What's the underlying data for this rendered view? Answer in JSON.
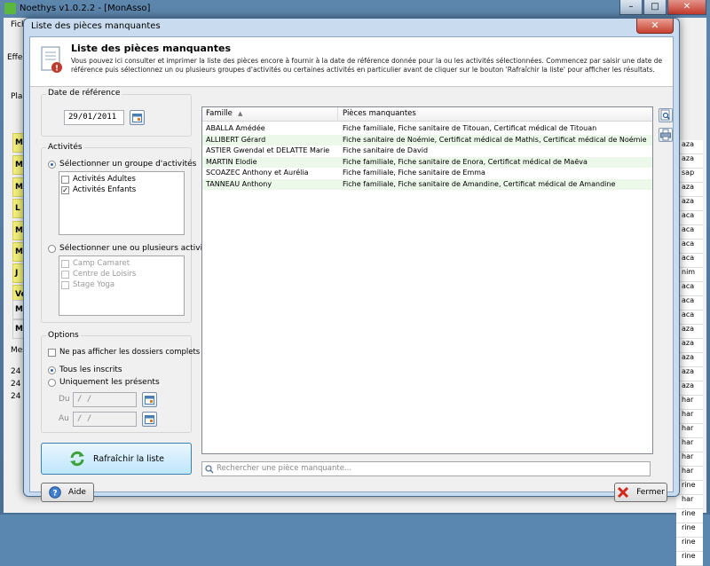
{
  "main_window": {
    "title": "Noethys v1.0.2.2 - [MonAsso]",
    "menu_first": "Fich",
    "tab_label": "Effecti",
    "place_label": "Place",
    "messages_label": "Messa",
    "left_cells": [
      "Me",
      "Me",
      "Me",
      "L",
      "M",
      "Me",
      "J",
      "Ve",
      "Mer",
      "Mer"
    ],
    "message_lines": [
      "24",
      "24",
      "24"
    ],
    "right_cells": [
      "aza",
      "aza",
      "sap",
      "aza",
      "aza",
      "aca",
      "aca",
      "aca",
      "aca",
      "nim",
      "aca",
      "aca",
      "aca",
      "aza",
      "aza",
      "aza",
      "aza",
      "aza",
      "har",
      "har",
      "har",
      "har",
      "har",
      "har",
      "rine",
      "har",
      "rine",
      "rine",
      "rine",
      "rine"
    ]
  },
  "dialog": {
    "title": "Liste des pièces manquantes",
    "header_title": "Liste des pièces manquantes",
    "header_desc": "Vous pouvez ici consulter et imprimer la liste des pièces encore à fournir à la date de référence donnée pour la ou les activités sélectionnées. Commencez par saisir une date de référence puis sélectionnez un ou plusieurs groupes d'activités ou certaines activités en particulier avant de cliquer sur le bouton 'Rafraîchir la liste' pour afficher les résultats.",
    "date_ref_label": "Date de référence",
    "date_ref_value": "29/01/2011",
    "activities_label": "Activités",
    "radio_groups_label": "Sélectionner un groupe d'activités",
    "groups": [
      {
        "label": "Activités Adultes",
        "checked": false
      },
      {
        "label": "Activités Enfants",
        "checked": true
      }
    ],
    "radio_activities_label": "Sélectionner une ou plusieurs activités",
    "activities": [
      {
        "label": "Camp Camaret"
      },
      {
        "label": "Centre de Loisirs"
      },
      {
        "label": "Stage Yoga"
      }
    ],
    "options_label": "Options",
    "option_hide_complete": "Ne pas afficher les dossiers complets",
    "radio_all": "Tous les inscrits",
    "radio_present": "Uniquement les présents",
    "from_label": "Du",
    "to_label": "Au",
    "from_value": "  /  /",
    "to_value": "  /  /",
    "refresh_button": "Rafraîchir la liste",
    "help_button": "Aide",
    "close_button": "Fermer",
    "search_placeholder": "Rechercher une pièce manquante...",
    "table": {
      "col_famille": "Famille",
      "col_pieces": "Pièces manquantes",
      "rows": [
        {
          "famille": "ABALLA Amédée",
          "pieces": "Fiche familiale, Fiche sanitaire de Titouan, Certificat médical de Titouan"
        },
        {
          "famille": "ALLIBERT Gérard",
          "pieces": "Fiche sanitaire de Noémie, Certificat médical de Mathis, Certificat médical de Noémie"
        },
        {
          "famille": "ASTIER Gwendal et DELATTE Marie",
          "pieces": "Fiche sanitaire de David"
        },
        {
          "famille": "MARTIN Elodie",
          "pieces": "Fiche familiale, Fiche sanitaire de Enora, Certificat médical de Maëva"
        },
        {
          "famille": "SCOAZEC Anthony et Aurélia",
          "pieces": "Fiche familiale, Fiche sanitaire de Emma"
        },
        {
          "famille": "TANNEAU Anthony",
          "pieces": "Fiche familiale, Fiche sanitaire de Amandine, Certificat médical de Amandine"
        }
      ]
    }
  }
}
